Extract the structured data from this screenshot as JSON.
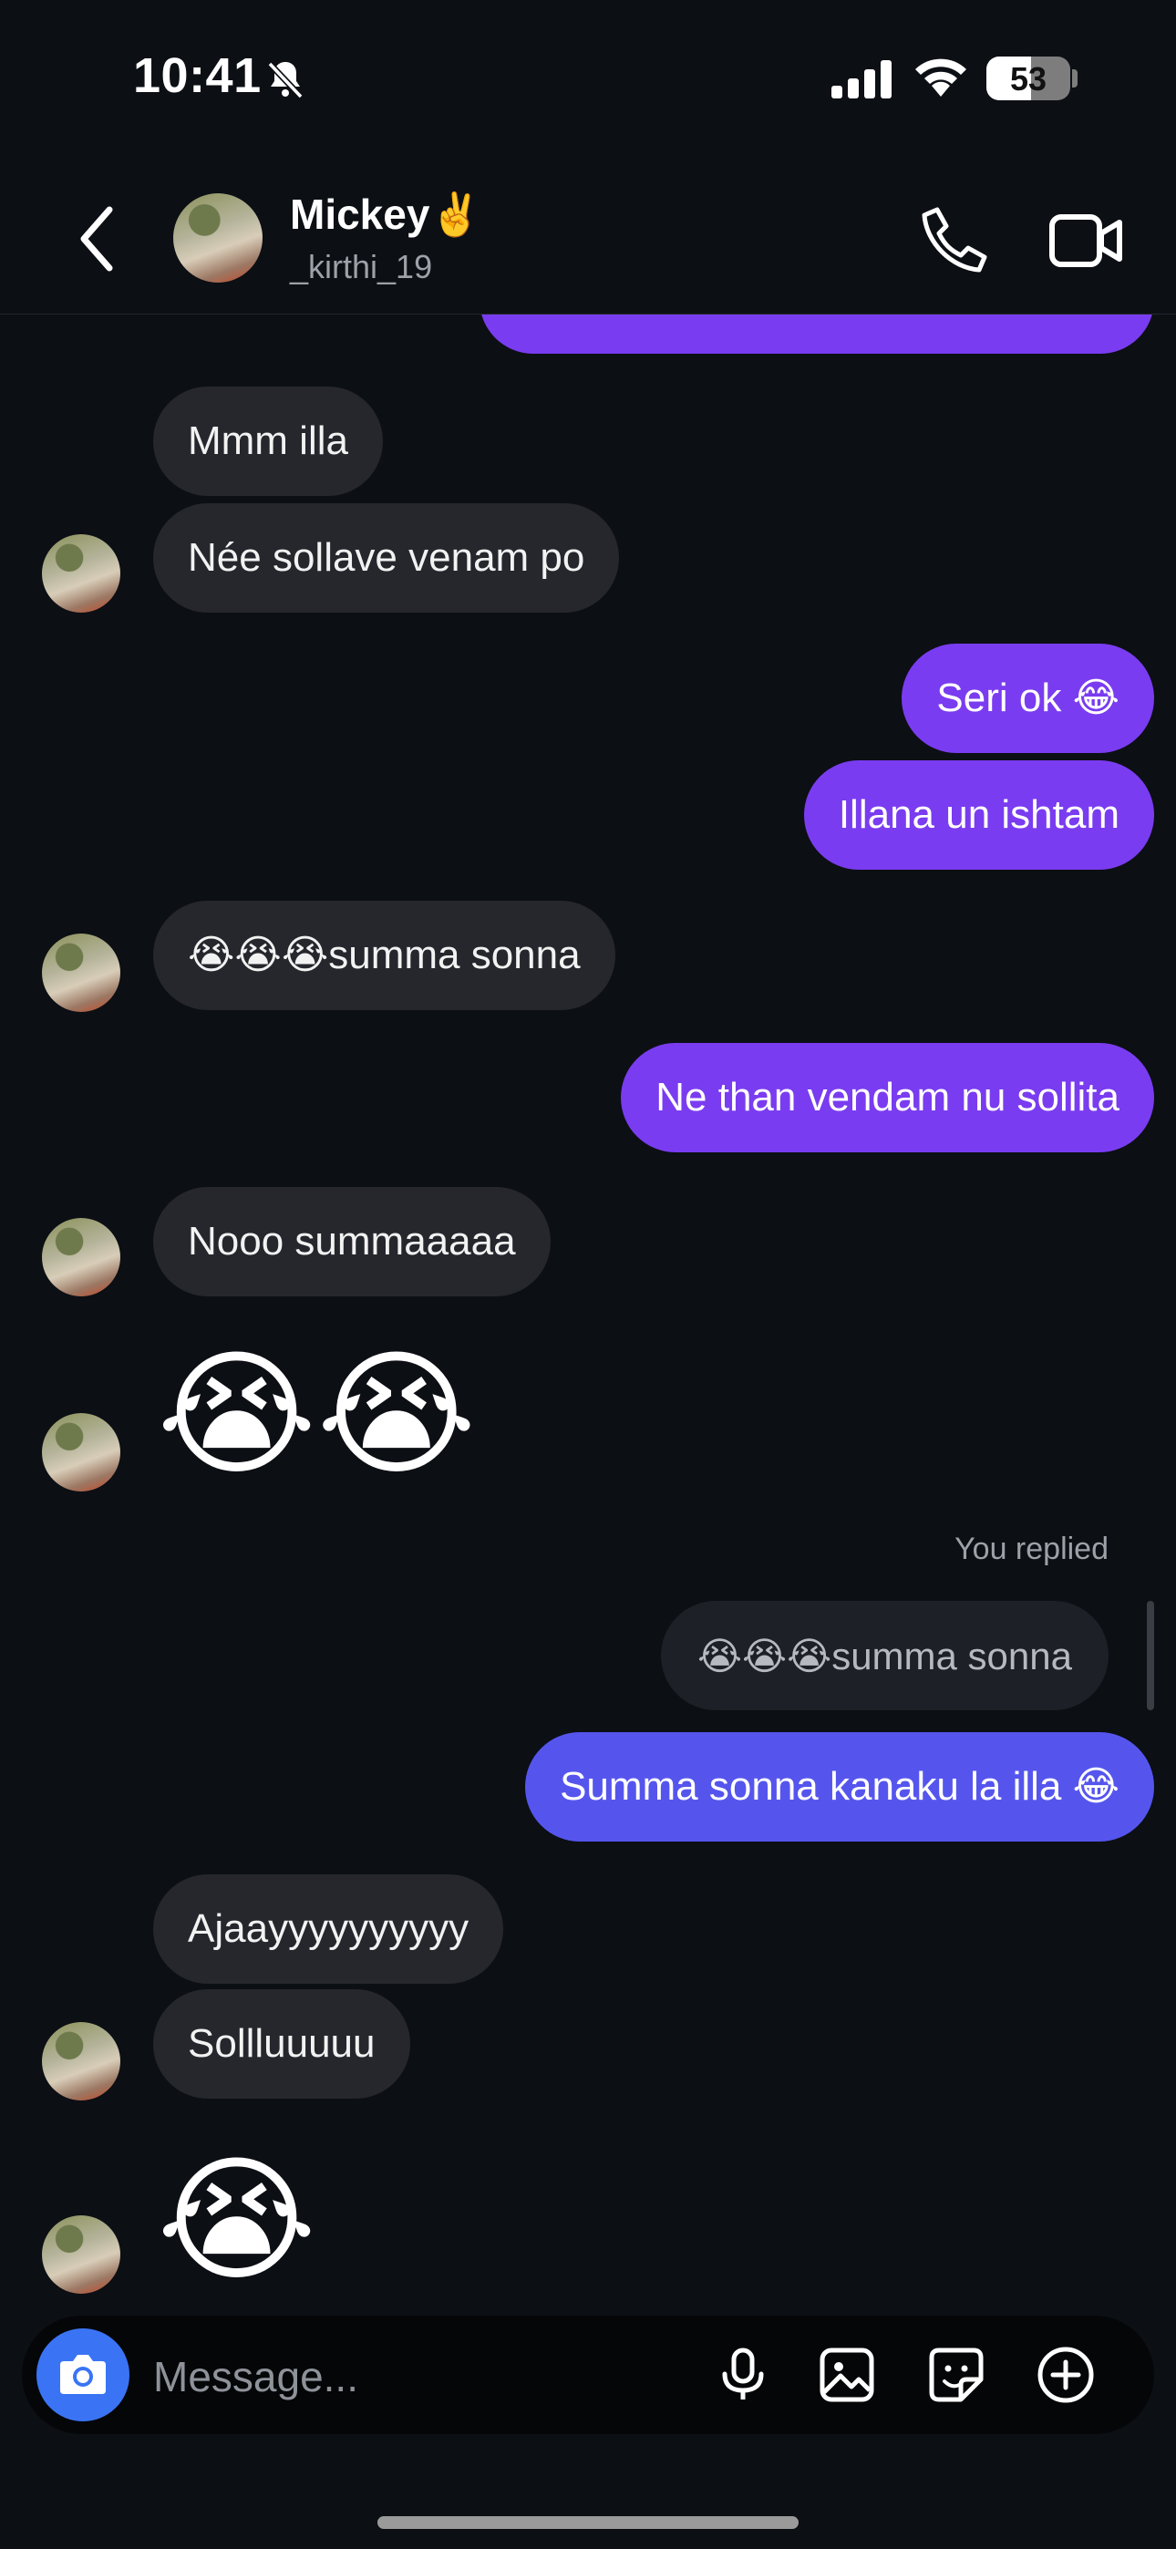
{
  "status_bar": {
    "time": "10:41",
    "battery": "53"
  },
  "header": {
    "name": "Mickey✌️",
    "handle": "_kirthi_19"
  },
  "messages": {
    "m1": "Mmm illa",
    "m2": "Née sollave venam po",
    "m3": "Seri ok 😂",
    "m4": "Illana un ishtam",
    "m5": "😭😭😭summa sonna",
    "m6": "Ne than vendam nu sollita",
    "m7": "Nooo summaaaaa",
    "m8": "😭😭",
    "replied_label": "You replied",
    "reply_quote": "😭😭😭summa sonna",
    "m9": "Summa sonna kanaku la illa 😂",
    "m10": "Ajaayyyyyyyyyy",
    "m11": "Sollluuuuu",
    "m12": "😭"
  },
  "composer": {
    "placeholder": "Message..."
  },
  "colors": {
    "outgoing": "#7a3cf0",
    "outgoing_reply": "#5555ee",
    "incoming": "#25272d",
    "background": "#0c0f14",
    "camera_button": "#3a74f5"
  },
  "icons": [
    "bell-slash-icon",
    "cellular-signal-icon",
    "wifi-icon",
    "battery-icon",
    "back-chevron-icon",
    "phone-icon",
    "video-camera-icon",
    "camera-icon",
    "microphone-icon",
    "image-icon",
    "sticker-icon",
    "plus-circle-icon"
  ]
}
